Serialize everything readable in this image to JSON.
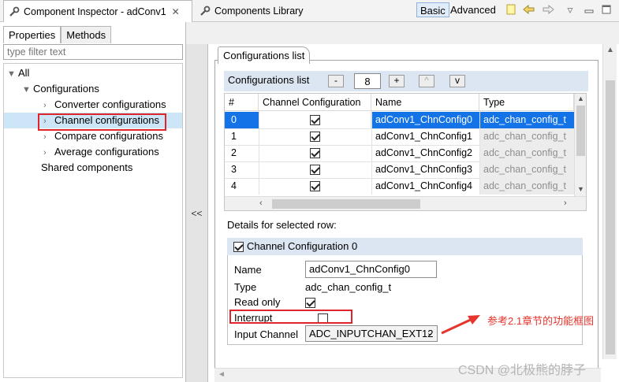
{
  "top_tabs": {
    "inspector": "Component Inspector - adConv1",
    "library": "Components Library"
  },
  "modes": {
    "basic": "Basic",
    "advanced": "Advanced"
  },
  "left": {
    "tabs": [
      "Properties",
      "Methods"
    ],
    "filter_placeholder": "type filter text",
    "tree": [
      {
        "label": "All"
      },
      {
        "label": "Configurations"
      },
      {
        "label": "Converter configurations"
      },
      {
        "label": "Channel configurations"
      },
      {
        "label": "Compare configurations"
      },
      {
        "label": "Average configurations"
      },
      {
        "label": "Shared components"
      }
    ]
  },
  "splitter": {
    "label": "<<"
  },
  "right": {
    "section_tab": "Configurations list",
    "list_title": "Configurations list",
    "buttons": {
      "minus": "-",
      "plus": "+",
      "up": "^",
      "down": "v"
    },
    "count": "8",
    "columns": [
      "#",
      "Channel Configuration",
      "Name",
      "Type"
    ],
    "rows": [
      {
        "idx": "0",
        "checked": true,
        "name": "adConv1_ChnConfig0",
        "type": "adc_chan_config_t"
      },
      {
        "idx": "1",
        "checked": true,
        "name": "adConv1_ChnConfig1",
        "type": "adc_chan_config_t"
      },
      {
        "idx": "2",
        "checked": true,
        "name": "adConv1_ChnConfig2",
        "type": "adc_chan_config_t"
      },
      {
        "idx": "3",
        "checked": true,
        "name": "adConv1_ChnConfig3",
        "type": "adc_chan_config_t"
      },
      {
        "idx": "4",
        "checked": true,
        "name": "adConv1_ChnConfig4",
        "type": "adc_chan_config_t"
      }
    ],
    "details_label": "Details for selected row:",
    "details": {
      "header": "Channel Configuration 0",
      "name_label": "Name",
      "name_value": "adConv1_ChnConfig0",
      "type_label": "Type",
      "type_value": "adc_chan_config_t",
      "readonly_label": "Read only",
      "interrupt_label": "Interrupt",
      "input_channel_label": "Input Channel",
      "input_channel_value": "ADC_INPUTCHAN_EXT12"
    }
  },
  "annotation": "参考2.1章节的功能框图",
  "watermark": "CSDN @北极熊的脖子",
  "colors": {
    "selection": "#1473e6",
    "highlight": "#e0242b",
    "header_bg": "#dce6f2"
  }
}
